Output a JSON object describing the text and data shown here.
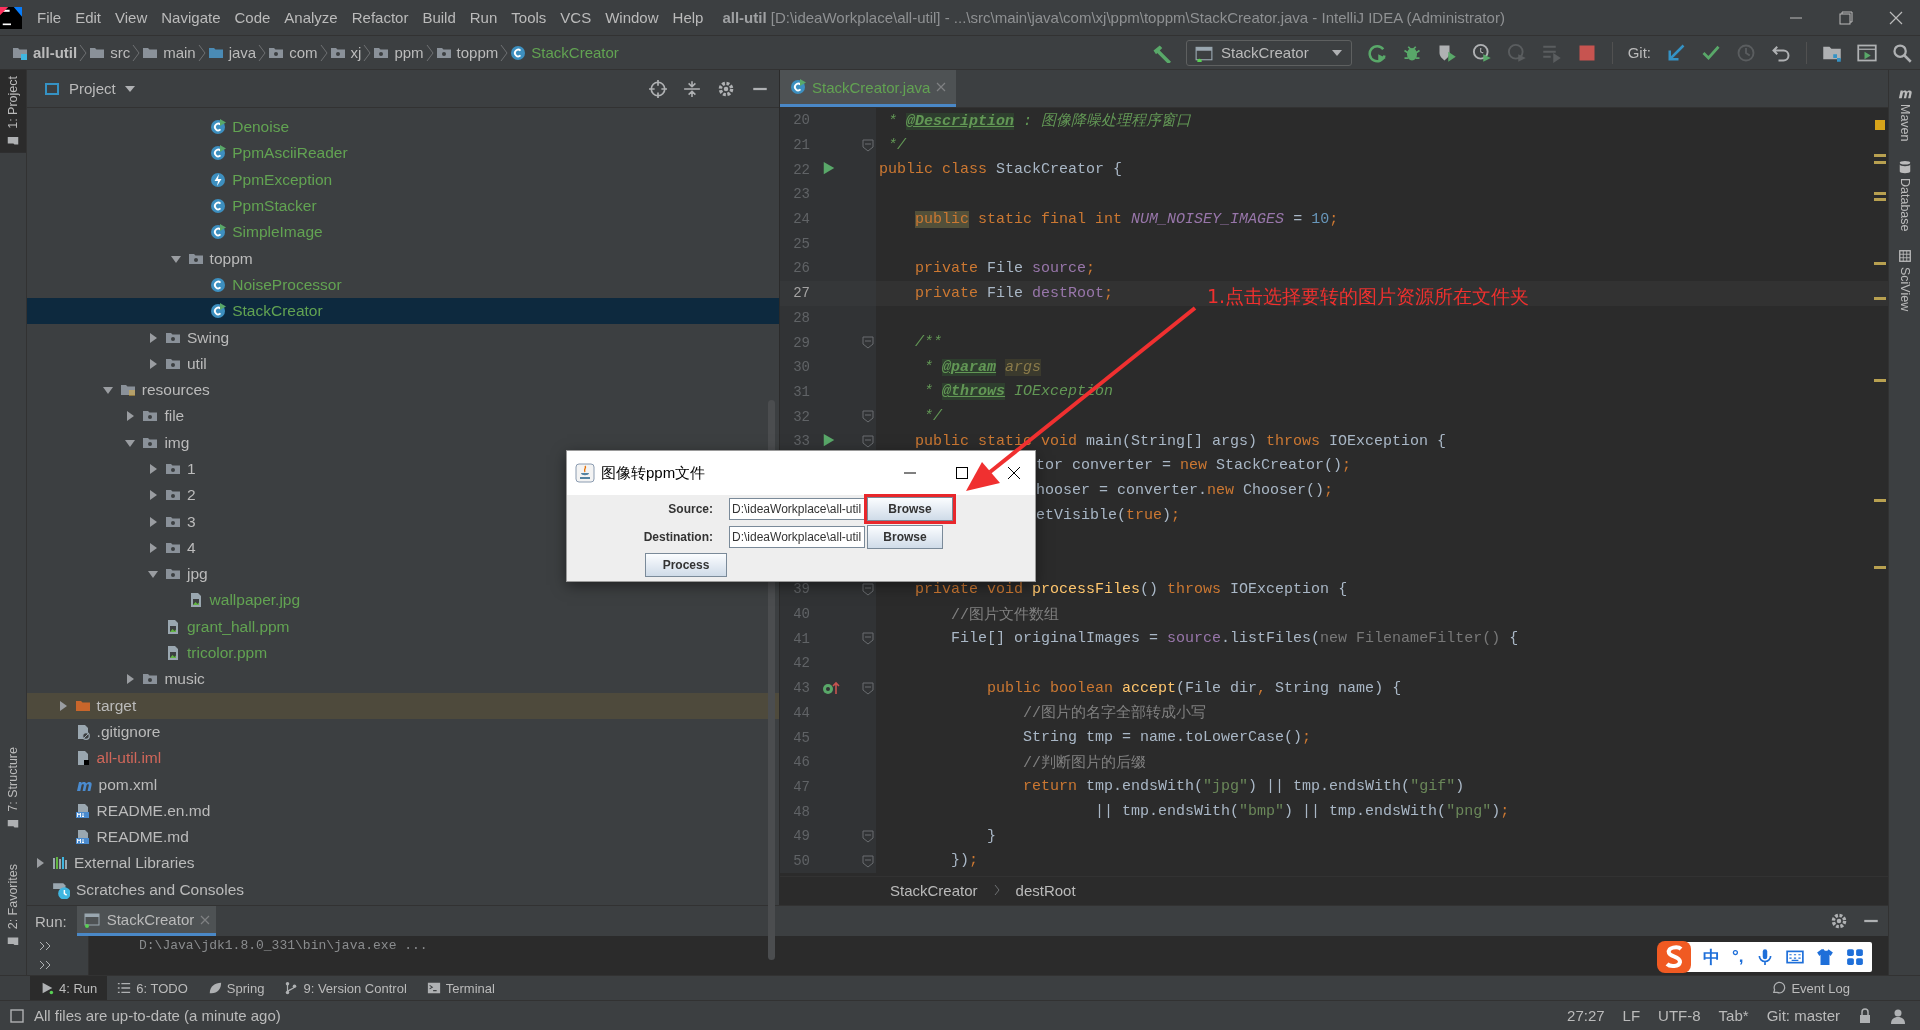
{
  "window": {
    "title": "**all-util** [D:\\ideaWorkplace\\all-util] - ...\\src\\main\\java\\com\\xj\\ppm\\toppm\\StackCreator.java - IntelliJ IDEA (Administrator)"
  },
  "menu": [
    "File",
    "Edit",
    "View",
    "Navigate",
    "Code",
    "Analyze",
    "Refactor",
    "Build",
    "Run",
    "Tools",
    "VCS",
    "Window",
    "Help"
  ],
  "breadcrumbs": [
    {
      "label": "all-util",
      "kind": "module"
    },
    {
      "label": "src",
      "kind": "folder"
    },
    {
      "label": "main",
      "kind": "folder"
    },
    {
      "label": "java",
      "kind": "source"
    },
    {
      "label": "com",
      "kind": "package"
    },
    {
      "label": "xj",
      "kind": "package"
    },
    {
      "label": "ppm",
      "kind": "package"
    },
    {
      "label": "toppm",
      "kind": "package"
    },
    {
      "label": "StackCreator",
      "kind": "class"
    }
  ],
  "toolbar": {
    "run_config": "StackCreator",
    "git_label": "Git:"
  },
  "left_tools": {
    "top": [
      {
        "label": "1: Project",
        "selected": true
      }
    ],
    "bottom": [
      {
        "label": "7: Structure",
        "selected": false
      },
      {
        "label": "2: Favorites",
        "selected": false
      }
    ]
  },
  "right_tools": [
    "Maven",
    "Database",
    "SciView"
  ],
  "project": {
    "title": "Project",
    "tree": [
      {
        "children": [
          {
            "children": [
              {
                "children": [
                  {
                    "children": [
                      {
                        "children": [
                          {
                            "children": [
                              {
                                "children": [
                                  {
                                    "label": "Denoise",
                                    "kind": "runnable-class",
                                    "color": "#62a352",
                                    "selected": false
                                  },
                                  {
                                    "label": "PpmAsciiReader",
                                    "kind": "runnable-class",
                                    "color": "#62a352",
                                    "selected": false
                                  },
                                  {
                                    "label": "PpmException",
                                    "kind": "exception",
                                    "color": "#62a352",
                                    "selected": false
                                  },
                                  {
                                    "label": "PpmStacker",
                                    "kind": "class",
                                    "color": "#62a352",
                                    "selected": false
                                  },
                                  {
                                    "label": "SimpleImage",
                                    "kind": "runnable-class",
                                    "color": "#62a352",
                                    "selected": false
                                  }
                                ]
                              },
                              {
                                "label": "toppm",
                                "kind": "package",
                                "expanded": true,
                                "selected": false,
                                "children": [
                                  {
                                    "label": "NoiseProcessor",
                                    "kind": "class",
                                    "color": "#62a352",
                                    "selected": false
                                  },
                                  {
                                    "label": "StackCreator",
                                    "kind": "runnable-class",
                                    "color": "#62a352",
                                    "selected": true
                                  }
                                ]
                              }
                            ]
                          },
                          {
                            "label": "Swing",
                            "kind": "package",
                            "expanded": false,
                            "selected": false
                          },
                          {
                            "label": "util",
                            "kind": "package",
                            "expanded": false,
                            "selected": false
                          }
                        ]
                      }
                    ]
                  },
                  {
                    "label": "resources",
                    "kind": "resources",
                    "expanded": true,
                    "selected": false,
                    "children": [
                      {
                        "label": "file",
                        "kind": "package",
                        "expanded": false,
                        "selected": false
                      },
                      {
                        "label": "img",
                        "kind": "package",
                        "expanded": true,
                        "selected": false,
                        "children": [
                          {
                            "label": "1",
                            "kind": "package",
                            "expanded": false,
                            "selected": false
                          },
                          {
                            "label": "2",
                            "kind": "package",
                            "expanded": false,
                            "selected": false
                          },
                          {
                            "label": "3",
                            "kind": "package",
                            "expanded": false,
                            "selected": false
                          },
                          {
                            "label": "4",
                            "kind": "package",
                            "expanded": false,
                            "selected": false
                          },
                          {
                            "label": "jpg",
                            "kind": "package",
                            "expanded": true,
                            "selected": false,
                            "children": [
                              {
                                "label": "wallpaper.jpg",
                                "kind": "image",
                                "color": "#62a352",
                                "selected": false
                              }
                            ]
                          },
                          {
                            "label": "grant_hall.ppm",
                            "kind": "image",
                            "color": "#62a352",
                            "selected": false
                          },
                          {
                            "label": "tricolor.ppm",
                            "kind": "image",
                            "color": "#62a352",
                            "selected": false
                          }
                        ]
                      },
                      {
                        "label": "music",
                        "kind": "package",
                        "expanded": false,
                        "selected": false
                      }
                    ]
                  }
                ]
              }
            ]
          },
          {
            "label": "target",
            "kind": "excluded",
            "expanded": false,
            "selected": false
          },
          {
            "label": ".gitignore",
            "kind": "ignore",
            "selected": false
          },
          {
            "label": "all-util.iml",
            "kind": "iml",
            "color": "#d1675a",
            "selected": false
          },
          {
            "label": "pom.xml",
            "kind": "maven",
            "selected": false
          },
          {
            "label": "README.en.md",
            "kind": "markdown",
            "selected": false
          },
          {
            "label": "README.md",
            "kind": "markdown",
            "selected": false
          }
        ]
      },
      {
        "label": "External Libraries",
        "kind": "libraries",
        "expanded": false,
        "selected": false
      },
      {
        "label": "Scratches and Consoles",
        "kind": "scratches",
        "selected": false
      }
    ]
  },
  "editor": {
    "tabs": [
      {
        "label": "StackCreator.java",
        "selected": true
      }
    ],
    "lines": [
      {
        "n": "20",
        "fold": false,
        "current": false,
        "tokens": [
          {
            "text": " * ",
            "kind": "doc"
          },
          {
            "text": "@Description",
            "kind": "doctag"
          },
          {
            "text": " : 图像降噪处理程序窗口",
            "kind": "doc"
          }
        ]
      },
      {
        "n": "21",
        "fold": true,
        "current": false,
        "tokens": [
          {
            "text": " */",
            "kind": "doc"
          }
        ]
      },
      {
        "n": "22",
        "fold": false,
        "current": false,
        "marker": {
          "kind": "run"
        },
        "tokens": [
          {
            "text": "public class ",
            "kind": "keyword"
          },
          {
            "text": "StackCreator {",
            "kind": "plain"
          }
        ]
      },
      {
        "n": "23",
        "fold": false,
        "current": false
      },
      {
        "n": "24",
        "fold": false,
        "current": false,
        "tokens": [
          {
            "text": "    public",
            "kind": "warning"
          },
          {
            "text": " static final int ",
            "kind": "keyword"
          },
          {
            "text": "NUM_NOISEY_IMAGES",
            "kind": "constant"
          },
          {
            "text": " = ",
            "kind": "plain"
          },
          {
            "text": "10",
            "kind": "number"
          },
          {
            "text": ";",
            "kind": "keyword"
          }
        ]
      },
      {
        "n": "25",
        "fold": false,
        "current": false
      },
      {
        "n": "26",
        "fold": false,
        "current": false,
        "tokens": [
          {
            "text": "    private ",
            "kind": "keyword"
          },
          {
            "text": "File ",
            "kind": "plain"
          },
          {
            "text": "source",
            "kind": "field"
          },
          {
            "text": ";",
            "kind": "keyword"
          }
        ]
      },
      {
        "n": "27",
        "fold": false,
        "current": true,
        "tokens": [
          {
            "text": "    private ",
            "kind": "keyword"
          },
          {
            "text": "File ",
            "kind": "plain"
          },
          {
            "text": "destRoot",
            "kind": "field"
          },
          {
            "text": ";",
            "kind": "keyword"
          }
        ]
      },
      {
        "n": "28",
        "fold": false,
        "current": false
      },
      {
        "n": "29",
        "fold": true,
        "current": false,
        "tokens": [
          {
            "text": "    /**",
            "kind": "doc"
          }
        ]
      },
      {
        "n": "30",
        "fold": false,
        "current": false,
        "tokens": [
          {
            "text": "     * ",
            "kind": "doc"
          },
          {
            "text": "@param",
            "kind": "doctag"
          },
          {
            "text": " args",
            "kind": "unused"
          }
        ]
      },
      {
        "n": "31",
        "fold": false,
        "current": false,
        "tokens": [
          {
            "text": "     * ",
            "kind": "doc"
          },
          {
            "text": "@throws",
            "kind": "doctag"
          },
          {
            "text": " IOException",
            "kind": "doc"
          }
        ]
      },
      {
        "n": "32",
        "fold": true,
        "current": false,
        "tokens": [
          {
            "text": "     */",
            "kind": "doc"
          }
        ]
      },
      {
        "n": "33",
        "fold": true,
        "current": false,
        "marker": {
          "kind": "run"
        },
        "tokens": [
          {
            "text": "    public static void ",
            "kind": "keyword"
          },
          {
            "text": "main(String[] args) ",
            "kind": "plain"
          },
          {
            "text": "throws ",
            "kind": "keyword"
          },
          {
            "text": "IOException {",
            "kind": "plain"
          }
        ]
      },
      {
        "kind": "covered",
        "tokens": [
          {
            "text": "tor converter = ",
            "kind": "plain"
          },
          {
            "text": "new ",
            "kind": "keyword"
          },
          {
            "text": "StackCreator()",
            "kind": "plain"
          },
          {
            "text": ";",
            "kind": "keyword"
          }
        ]
      },
      {
        "kind": "covered",
        "tokens": [
          {
            "text": "hooser = converter.",
            "kind": "plain"
          },
          {
            "text": "new ",
            "kind": "keyword"
          },
          {
            "text": "Chooser()",
            "kind": "plain"
          },
          {
            "text": ";",
            "kind": "keyword"
          }
        ]
      },
      {
        "kind": "covered",
        "tokens": [
          {
            "text": "etVisible(",
            "kind": "plain"
          },
          {
            "text": "true",
            "kind": "keyword"
          },
          {
            "text": ")",
            "kind": "plain"
          },
          {
            "text": ";",
            "kind": "keyword"
          }
        ]
      },
      {
        "kind": "hidden"
      },
      {
        "kind": "hidden"
      },
      {
        "n": "39",
        "fold": true,
        "current": false,
        "tokens": [
          {
            "text": "    private void ",
            "kind": "keyword"
          },
          {
            "text": "processFiles",
            "kind": "method"
          },
          {
            "text": "() ",
            "kind": "plain"
          },
          {
            "text": "throws ",
            "kind": "keyword"
          },
          {
            "text": "IOException {",
            "kind": "plain"
          }
        ]
      },
      {
        "n": "40",
        "fold": false,
        "current": false,
        "tokens": [
          {
            "text": "        //图片文件数组",
            "kind": "comment"
          }
        ]
      },
      {
        "n": "41",
        "fold": true,
        "current": false,
        "tokens": [
          {
            "text": "        File[] originalImages = ",
            "kind": "plain"
          },
          {
            "text": "source",
            "kind": "field"
          },
          {
            "text": ".listFiles(",
            "kind": "plain"
          },
          {
            "text": "new FilenameFilter() ",
            "kind": "dimmed"
          },
          {
            "text": "{",
            "kind": "plain"
          }
        ]
      },
      {
        "n": "42",
        "fold": false,
        "current": false
      },
      {
        "n": "43",
        "fold": true,
        "current": false,
        "marker": {
          "kind": "override"
        },
        "tokens": [
          {
            "text": "            public boolean ",
            "kind": "keyword"
          },
          {
            "text": "accept",
            "kind": "method"
          },
          {
            "text": "(File dir",
            "kind": "plain"
          },
          {
            "text": ", ",
            "kind": "keyword"
          },
          {
            "text": "String name) {",
            "kind": "plain"
          }
        ]
      },
      {
        "n": "44",
        "fold": false,
        "current": false,
        "tokens": [
          {
            "text": "                //图片的名字全部转成小写",
            "kind": "comment"
          }
        ]
      },
      {
        "n": "45",
        "fold": false,
        "current": false,
        "tokens": [
          {
            "text": "                String tmp = name.toLowerCase()",
            "kind": "plain"
          },
          {
            "text": ";",
            "kind": "keyword"
          }
        ]
      },
      {
        "n": "46",
        "fold": false,
        "current": false,
        "tokens": [
          {
            "text": "                //判断图片的后缀",
            "kind": "comment"
          }
        ]
      },
      {
        "n": "47",
        "fold": false,
        "current": false,
        "tokens": [
          {
            "text": "                return ",
            "kind": "keyword"
          },
          {
            "text": "tmp.endsWith(",
            "kind": "plain"
          },
          {
            "text": "\"jpg\"",
            "kind": "string"
          },
          {
            "text": ") || tmp.endsWith(",
            "kind": "plain"
          },
          {
            "text": "\"gif\"",
            "kind": "string"
          },
          {
            "text": ")",
            "kind": "plain"
          }
        ]
      },
      {
        "n": "48",
        "fold": false,
        "current": false,
        "tokens": [
          {
            "text": "                        || tmp.endsWith(",
            "kind": "plain"
          },
          {
            "text": "\"bmp\"",
            "kind": "string"
          },
          {
            "text": ") || tmp.endsWith(",
            "kind": "plain"
          },
          {
            "text": "\"png\"",
            "kind": "string"
          },
          {
            "text": ")",
            "kind": "plain"
          },
          {
            "text": ";",
            "kind": "keyword"
          }
        ]
      },
      {
        "n": "49",
        "fold": true,
        "current": false,
        "tokens": [
          {
            "text": "            }",
            "kind": "plain"
          }
        ]
      },
      {
        "n": "50",
        "fold": true,
        "current": false,
        "tokens": [
          {
            "text": "        })",
            "kind": "plain"
          },
          {
            "text": ";",
            "kind": "keyword"
          }
        ]
      }
    ],
    "breadcrumb": [
      "StackCreator",
      "destRoot"
    ]
  },
  "dialog": {
    "title": "图像转ppm文件",
    "rows": [
      {
        "label": "Source:",
        "value": "D:\\ideaWorkplace\\all-util",
        "button": "Browse",
        "highlighted": true
      },
      {
        "label": "Destination:",
        "value": "D:\\ideaWorkplace\\all-util",
        "button": "Browse",
        "highlighted": false
      }
    ],
    "action": "Process"
  },
  "annotation": {
    "text": "1.点击选择要转的图片资源所在文件夹"
  },
  "run": {
    "label": "Run:",
    "tabs": [
      {
        "label": "StackCreator",
        "selected": true
      }
    ],
    "console": "D:\\Java\\jdk1.8.0_331\\bin\\java.exe ..."
  },
  "tool_buttons": [
    {
      "label": "4: Run",
      "kind": "run",
      "selected": true
    },
    {
      "label": "6: TODO",
      "kind": "todo",
      "selected": false
    },
    {
      "label": "Spring",
      "kind": "spring",
      "selected": false
    },
    {
      "label": "9: Version Control",
      "kind": "vcs",
      "selected": false
    },
    {
      "label": "Terminal",
      "kind": "terminal",
      "selected": false
    }
  ],
  "event_log": "Event Log",
  "status": {
    "message": "All files are up-to-date (a minute ago)",
    "items": [
      "27:27",
      "LF",
      "UTF-8",
      "Tab*",
      "Git: master"
    ]
  },
  "ime": {
    "mode": "中",
    "punct": "°,"
  }
}
